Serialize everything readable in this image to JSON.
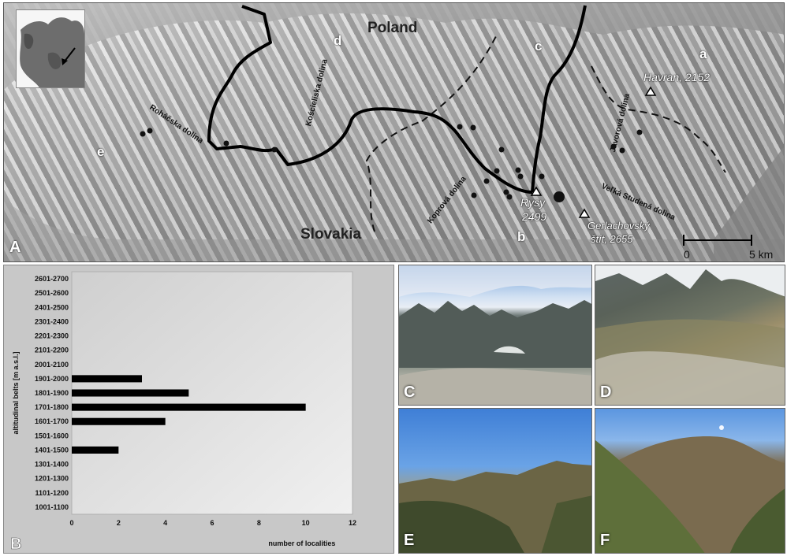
{
  "map": {
    "panel_label": "A",
    "countries": {
      "north": "Poland",
      "south": "Slovakia"
    },
    "region_letters": [
      "a",
      "b",
      "c",
      "d",
      "e"
    ],
    "valleys": {
      "rohacska": "Roháčska dolina",
      "kosciel": "Kościeliska dolina",
      "koprova": "Koprová dolina",
      "javorova": "Javorová dolina",
      "velka": "Veľká Studená dolina"
    },
    "peaks": {
      "havran": "Havran, 2152",
      "rysy_name": "Rysy",
      "rysy_alt": "2499",
      "gerl_name": "Gerlachovský",
      "gerl_alt": "štít, 2655"
    },
    "scale": {
      "start": "0",
      "end": "5 km"
    }
  },
  "chart_data": {
    "type": "bar",
    "orientation": "horizontal",
    "panel_label": "B",
    "ylabel": "altitudinal belts [m a.s.l.]",
    "xlabel": "number of localities",
    "categories": [
      "1001-1100",
      "1101-1200",
      "1201-1300",
      "1301-1400",
      "1401-1500",
      "1501-1600",
      "1601-1700",
      "1701-1800",
      "1801-1900",
      "1901-2000",
      "2001-2100",
      "2101-2200",
      "2201-2300",
      "2301-2400",
      "2401-2500",
      "2501-2600",
      "2601-2700"
    ],
    "values": [
      0,
      0,
      0,
      0,
      2,
      0,
      4,
      10,
      5,
      3,
      0,
      0,
      0,
      0,
      0,
      0,
      0
    ],
    "xlim": [
      0,
      12
    ],
    "xticks": [
      "0",
      "2",
      "4",
      "6",
      "8",
      "10",
      "12"
    ],
    "bar_color": "#000000",
    "grid": false
  },
  "photos": {
    "c": "C",
    "d": "D",
    "e": "E",
    "f": "F"
  }
}
